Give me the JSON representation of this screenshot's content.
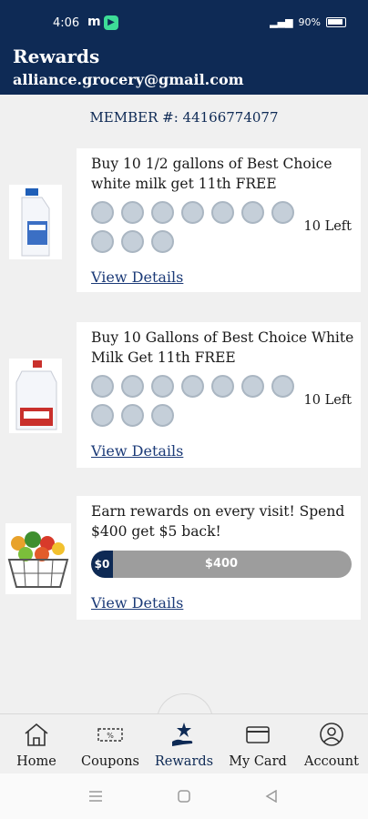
{
  "status": {
    "time": "4:06",
    "m": "m",
    "battery": "90%"
  },
  "header": {
    "title": "Rewards",
    "email": "alliance.grocery@gmail.com"
  },
  "member": {
    "label": "MEMBER #: 44166774077"
  },
  "rewards": [
    {
      "title": "Buy 10 1/2 gallons of Best Choice white milk get 11th FREE",
      "stamps_total": 10,
      "stamps_filled": 0,
      "left_text": "10 Left",
      "details": "View Details",
      "image": "half-gallon-milk-image"
    },
    {
      "title": "Buy 10 Gallons of Best Choice White Milk Get 11th FREE",
      "stamps_total": 10,
      "stamps_filled": 0,
      "left_text": "10 Left",
      "details": "View Details",
      "image": "gallon-milk-image"
    },
    {
      "title": "Earn rewards on every visit! Spend $400 get $5 back!",
      "progress_start": "$0",
      "progress_end": "$400",
      "progress_fraction": 0,
      "details": "View Details",
      "image": "grocery-basket-image"
    }
  ],
  "nav": [
    {
      "label": "Home",
      "icon": "home-icon"
    },
    {
      "label": "Coupons",
      "icon": "coupon-icon"
    },
    {
      "label": "Rewards",
      "icon": "rewards-icon",
      "active": true
    },
    {
      "label": "My Card",
      "icon": "card-icon"
    },
    {
      "label": "Account",
      "icon": "account-icon"
    }
  ],
  "colors": {
    "header_bg": "#0e2a55",
    "stamp": "#c5cfd9",
    "link": "#1c3b78"
  }
}
